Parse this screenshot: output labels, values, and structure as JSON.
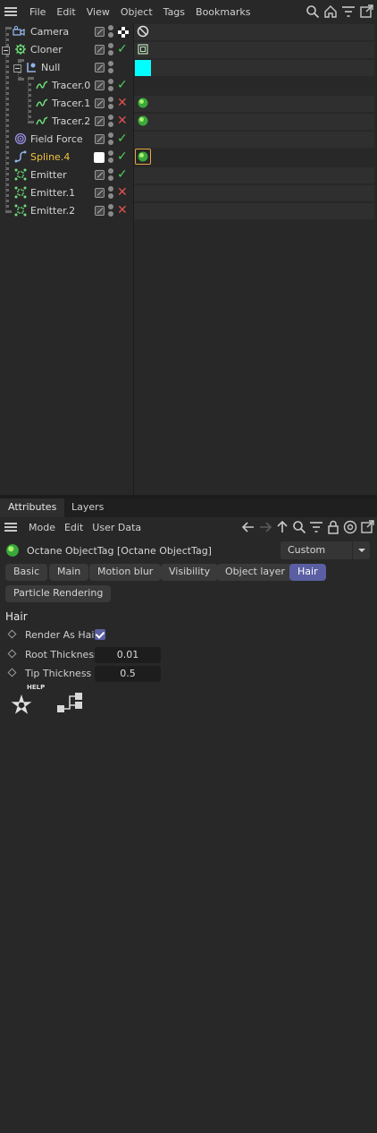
{
  "object_manager": {
    "menu": [
      "File",
      "Edit",
      "View",
      "Object",
      "Tags",
      "Bookmarks"
    ],
    "toolbar_icons": [
      "search-icon",
      "home-icon",
      "filter-icon",
      "new-window-icon"
    ],
    "objects": [
      {
        "name": "Camera",
        "icon": "camera-icon",
        "status": "none",
        "tag": "protection-tag"
      },
      {
        "name": "Cloner",
        "icon": "cloner-icon",
        "status": "check",
        "tag": "cloner-tag"
      },
      {
        "name": "Null",
        "icon": "null-icon",
        "status": "none",
        "tag": "display-tag"
      },
      {
        "name": "Tracer.0",
        "icon": "tracer-icon",
        "status": "check",
        "tag": ""
      },
      {
        "name": "Tracer.1",
        "icon": "tracer-icon",
        "status": "cross",
        "tag": "octane-object-tag"
      },
      {
        "name": "Tracer.2",
        "icon": "tracer-icon",
        "status": "cross",
        "tag": "octane-object-tag"
      },
      {
        "name": "Field Force",
        "icon": "field-force-icon",
        "status": "check",
        "tag": ""
      },
      {
        "name": "Spline.4",
        "icon": "spline-icon",
        "status": "check",
        "tag": "octane-object-tag-selected"
      },
      {
        "name": "Emitter",
        "icon": "emitter-icon",
        "status": "check",
        "tag": ""
      },
      {
        "name": "Emitter.1",
        "icon": "emitter-icon",
        "status": "cross",
        "tag": ""
      },
      {
        "name": "Emitter.2",
        "icon": "emitter-icon",
        "status": "cross",
        "tag": ""
      }
    ]
  },
  "attributes": {
    "tabs": [
      "Attributes",
      "Layers"
    ],
    "menu": [
      "Mode",
      "Edit",
      "User Data"
    ],
    "object_title": "Octane ObjectTag [Octane ObjectTag]",
    "preset": "Custom",
    "buttons": [
      "Basic",
      "Main",
      "Motion blur",
      "Visibility",
      "Object layer",
      "Hair",
      "Particle Rendering"
    ],
    "active_button": "Hair",
    "section": "Hair",
    "params": [
      {
        "label": "Render As Hair",
        "type": "checkbox",
        "checked": true
      },
      {
        "label": "Root Thickness",
        "type": "number",
        "value": "0.01"
      },
      {
        "label": "Tip Thickness",
        "type": "number",
        "value": "0.5"
      }
    ],
    "help_label": "HELP"
  },
  "colors": {
    "accent": "#5a5fa3",
    "check": "#4fd15a",
    "cross": "#e05151",
    "selected_text": "#f0c23a",
    "cyan_tag": "#00ffff"
  }
}
